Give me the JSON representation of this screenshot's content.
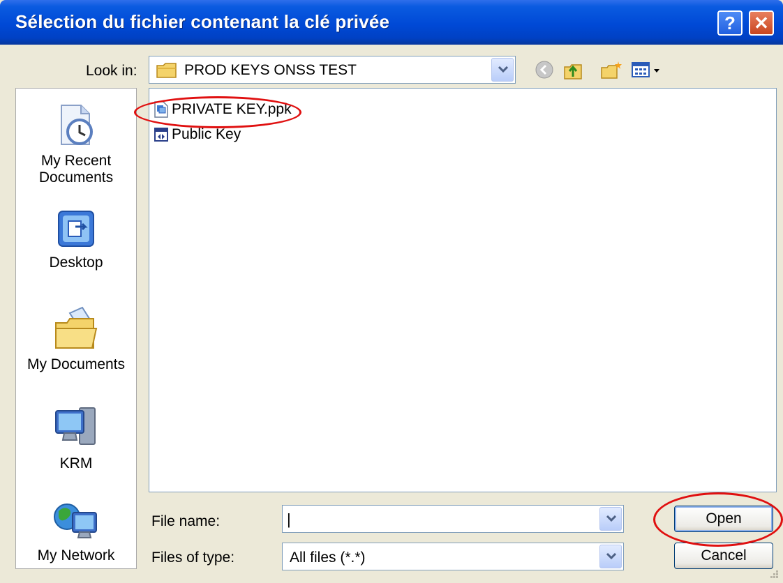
{
  "dialog": {
    "title": "Sélection du fichier contenant la clé privée",
    "help_glyph": "?",
    "close_glyph": "✕"
  },
  "lookin": {
    "label": "Look in:",
    "value": "PROD KEYS ONSS TEST"
  },
  "places": [
    {
      "label_line1": "My Recent",
      "label_line2": "Documents",
      "icon": "recent-documents-icon"
    },
    {
      "label_line1": "Desktop",
      "label_line2": "",
      "icon": "desktop-icon"
    },
    {
      "label_line1": "My Documents",
      "label_line2": "",
      "icon": "my-documents-icon"
    },
    {
      "label_line1": "KRM",
      "label_line2": "",
      "icon": "computer-icon"
    },
    {
      "label_line1": "My Network",
      "label_line2": "",
      "icon": "network-icon"
    }
  ],
  "files": [
    {
      "name": "PRIVATE KEY.ppk",
      "icon": "ppk-file-icon"
    },
    {
      "name": "Public Key",
      "icon": "generic-file-icon"
    }
  ],
  "form": {
    "filename_label": "File name:",
    "filename_value": "|",
    "filetype_label": "Files of type:",
    "filetype_value": "All files (*.*)"
  },
  "buttons": {
    "open": "Open",
    "cancel": "Cancel"
  },
  "colors": {
    "titlebar": "#0049D6",
    "dialog_bg": "#ECE9D8",
    "highlight_ring": "#E01010"
  }
}
